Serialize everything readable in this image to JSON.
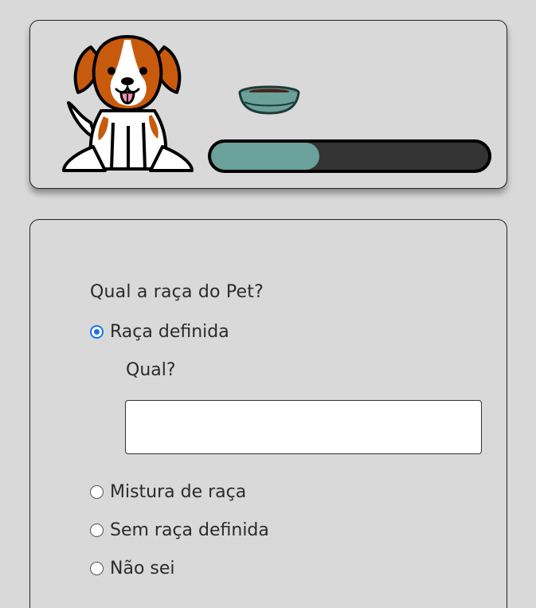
{
  "header": {
    "progress_fraction": 0.39,
    "colors": {
      "progress_fill": "#6aa19a",
      "progress_track": "#333333",
      "dog_fur": "#c85a0e",
      "bowl": "#5f9590"
    },
    "icons": {
      "pet": "dog-illustration",
      "food": "food-bowl-icon"
    }
  },
  "form": {
    "question": "Qual a raça do Pet?",
    "options": [
      {
        "label": "Raça definida",
        "checked": true
      },
      {
        "label": "Mistura de raça",
        "checked": false
      },
      {
        "label": "Sem raça definida",
        "checked": false
      },
      {
        "label": "Não sei",
        "checked": false
      }
    ],
    "breed_prompt": "Qual?",
    "breed_input": {
      "value": "",
      "placeholder": ""
    }
  }
}
